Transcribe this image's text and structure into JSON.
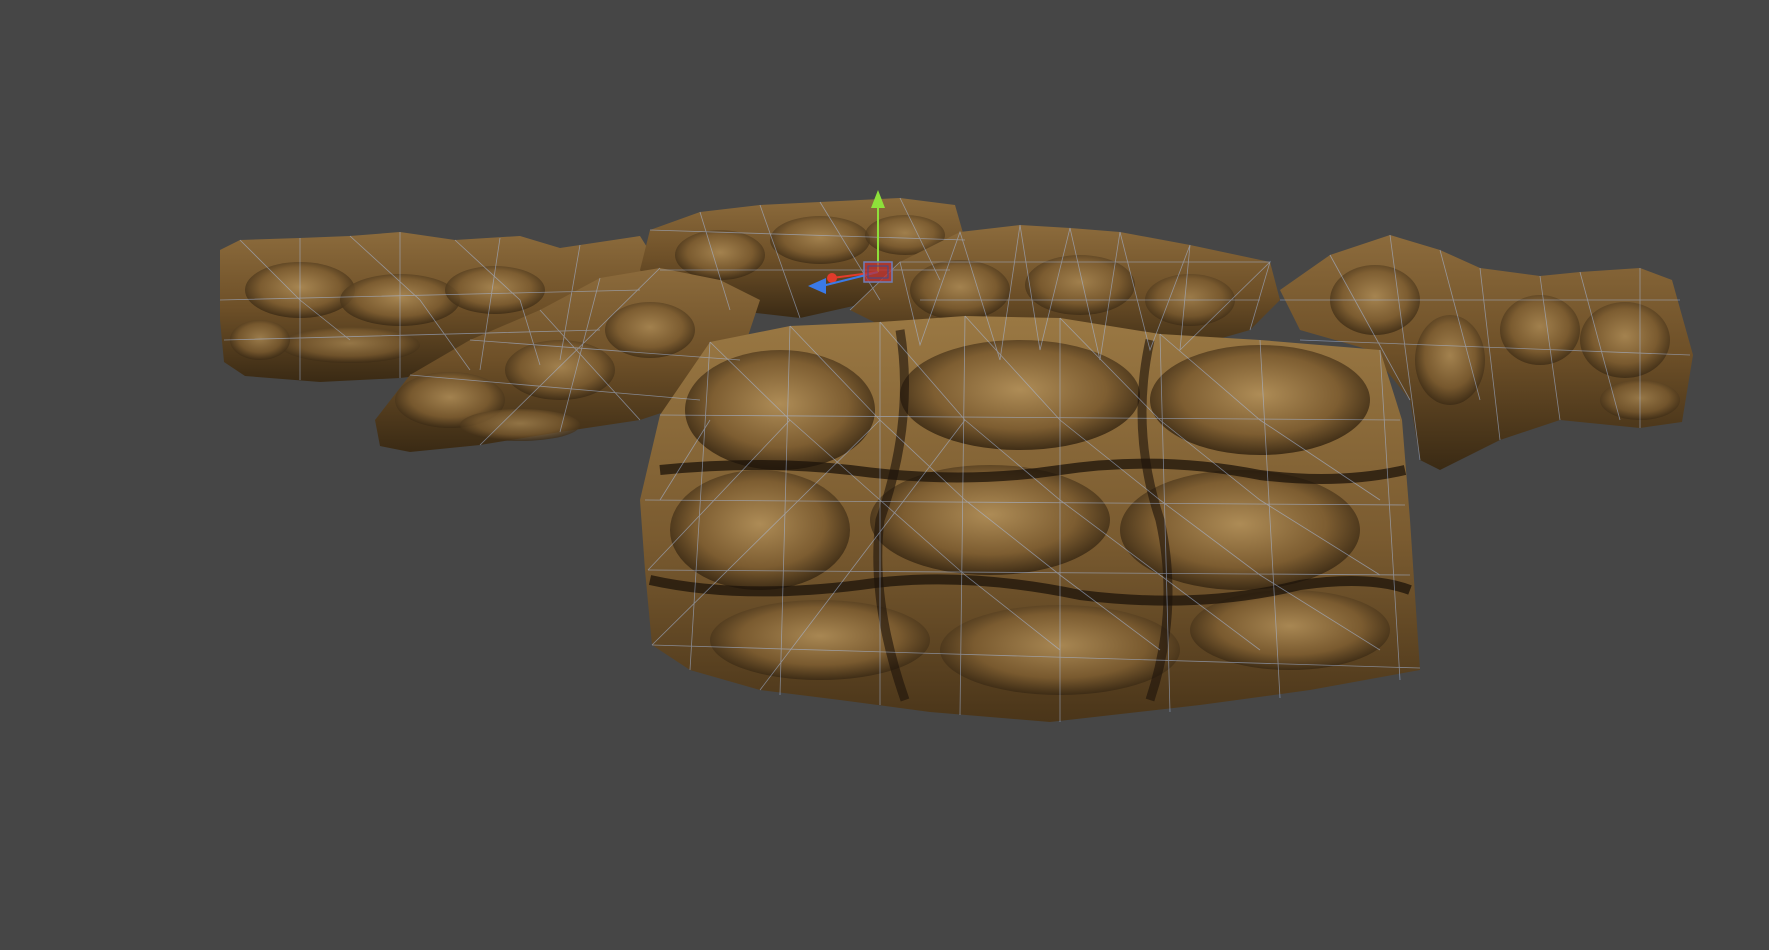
{
  "viewport": {
    "background_color": "#464646",
    "scene_object": "rock-wall-mesh",
    "display_mode": "textured-with-wireframe-overlay",
    "wireframe_color": "#9fb6e0",
    "rock_colors": {
      "light": "#a88552",
      "mid": "#7a5a30",
      "dark": "#2e2110",
      "crevice": "#1a120a"
    }
  },
  "gizmo": {
    "type": "transform-gizmo",
    "axes": [
      {
        "name": "y-axis",
        "color": "#8ee03a",
        "icon": "arrow-up-icon"
      },
      {
        "name": "x-axis",
        "color": "#e23b2b",
        "icon": "dot-icon"
      },
      {
        "name": "z-axis",
        "color": "#3a7ae8",
        "icon": "arrow-left-icon"
      }
    ],
    "center_handle_color": "#c23232"
  }
}
